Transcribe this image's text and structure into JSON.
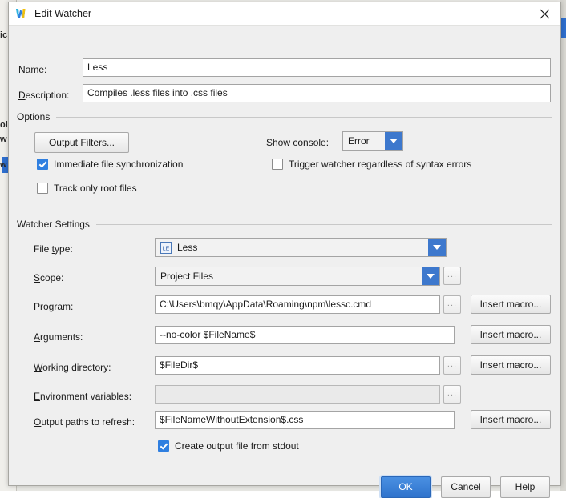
{
  "backdrop": {
    "fragments": [
      "ic",
      "ol",
      "w",
      "w"
    ]
  },
  "dialog": {
    "title": "Edit Watcher",
    "app_icon": "webstorm-icon",
    "close_icon": "close-icon"
  },
  "fields": {
    "name_label": "Name:",
    "name_mnemonic": "N",
    "name_value": "Less",
    "description_label": "Description:",
    "description_mnemonic": "D",
    "description_value": "Compiles .less files into .css files"
  },
  "options": {
    "group_title": "Options",
    "output_filters_button": "Output Filters...",
    "output_filters_mnemonic": "F",
    "show_console_label": "Show console:",
    "show_console_value": "Error",
    "immediate_sync_label": "Immediate file synchronization",
    "immediate_sync_checked": true,
    "trigger_watcher_label": "Trigger watcher regardless of syntax errors",
    "trigger_watcher_checked": false,
    "track_root_label": "Track only root files",
    "track_root_checked": false
  },
  "watcher_settings": {
    "group_title": "Watcher Settings",
    "file_type_label": "File type:",
    "file_type_mnemonic": "t",
    "file_type_value": "Less",
    "file_type_icon": "less-file-icon",
    "scope_label": "Scope:",
    "scope_mnemonic": "S",
    "scope_value": "Project Files",
    "program_label": "Program:",
    "program_mnemonic": "P",
    "program_value": "C:\\Users\\bmqy\\AppData\\Roaming\\npm\\lessc.cmd",
    "arguments_label": "Arguments:",
    "arguments_mnemonic": "A",
    "arguments_value": "--no-color $FileName$",
    "working_dir_label": "Working directory:",
    "working_dir_mnemonic": "W",
    "working_dir_value": "$FileDir$",
    "env_vars_label": "Environment variables:",
    "env_vars_mnemonic": "E",
    "env_vars_value": "",
    "output_paths_label": "Output paths to refresh:",
    "output_paths_mnemonic": "O",
    "output_paths_value": "$FileNameWithoutExtension$.css",
    "create_output_label": "Create output file from stdout",
    "create_output_checked": true,
    "insert_macro_button": "Insert macro...",
    "browse_button": "...",
    "insert_macro_count": 4
  },
  "footer": {
    "ok_label": "OK",
    "cancel_label": "Cancel",
    "help_label": "Help"
  },
  "colors": {
    "accent_blue": "#3d78cd",
    "ok_blue": "#2f73cc",
    "checkbox_blue": "#2f7fe0",
    "dialog_bg": "#efefef",
    "field_bg": "#ffffff"
  }
}
